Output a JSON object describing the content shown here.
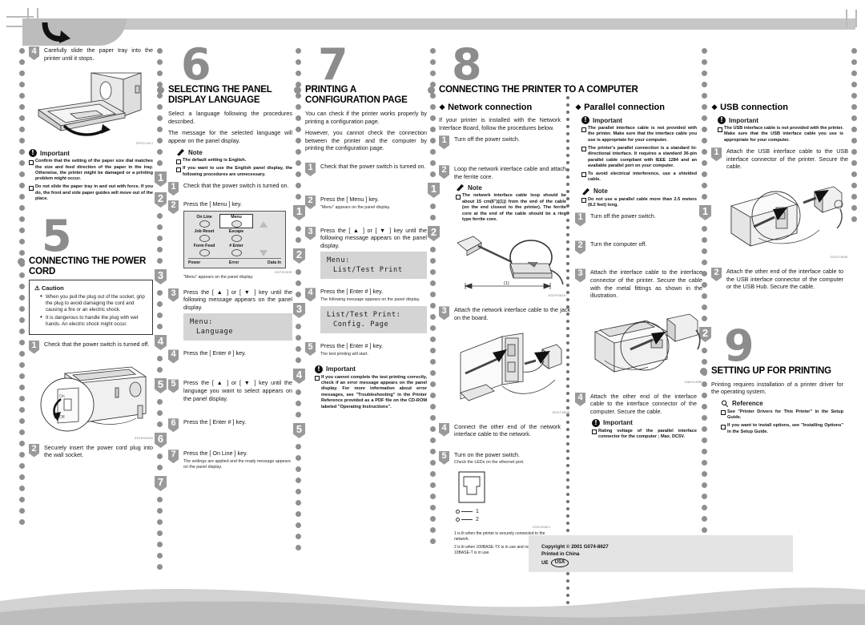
{
  "document": {
    "type": "printer-quick-installation-guide",
    "footer": {
      "copyright": "Copyright © 2001 G074-8627",
      "printed": "Printed in China",
      "ue_label": "UE",
      "region": "USA"
    }
  },
  "col1": {
    "step4": {
      "num": "4",
      "text": "Carefully slide the paper tray into the printer until it stops.",
      "figcode": "ZFEV140J"
    },
    "important": {
      "heading": "Important",
      "icon": "important-icon",
      "items": [
        "Confirm that the setting of the paper size dial matches the size and feed direction of the paper in the tray. Otherwise, the printer might be damaged or a printing problem might occur.",
        "Do not slide the paper tray in and out with force. If you do, the front and side paper guides will move out of the place."
      ]
    },
    "section5": {
      "number": "5",
      "title": "CONNECTING THE POWER CORD",
      "caution": {
        "heading": "Caution",
        "items": [
          "When you pull the plug out of the socket, grip the plug to avoid damaging the cord and causing a fire or an electric shock.",
          "It is dangerous to handle the plug with wet hands. An electric shock might occur."
        ]
      },
      "steps": [
        {
          "num": "1",
          "text": "Check that the power switch is turned off.",
          "figcode": "ZDHH204N"
        },
        {
          "num": "2",
          "text": "Securely insert the power cord plug into the wall socket."
        }
      ]
    }
  },
  "col2": {
    "section6": {
      "number": "6",
      "title": "SELECTING THE PANEL DISPLAY LANGUAGE",
      "intro1": "Select a language following the procedures described.",
      "intro2": "The message for the selected language will appear on the panel display.",
      "note": {
        "heading": "Note",
        "items": [
          "The default setting is English.",
          "If you want to use the English panel display, the following procedures are unnecessary."
        ]
      },
      "steps": [
        {
          "num": "1",
          "text": "Check that the power switch is turned on."
        },
        {
          "num": "2",
          "text": "Press the [ Menu ] key.",
          "caption": "\"Menu\" appears on the panel display."
        },
        {
          "num": "3",
          "text": "Press the [ ▲ ] or [ ▼ ] key until the following message appears on the panel display.",
          "lcd1": "Menu:",
          "lcd2": "Language"
        },
        {
          "num": "4",
          "text": "Press the [ Enter # ] key."
        },
        {
          "num": "5",
          "text": "Press the [ ▲ ] or [ ▼ ] key until the language you want to select appears on the panel display."
        },
        {
          "num": "6",
          "text": "Press the [ Enter # ] key."
        },
        {
          "num": "7",
          "text": "Press the [ On Line ] key.",
          "caption": "The settings are applied and the ready message appears on the panel display."
        }
      ],
      "panel": {
        "keys": [
          "On Line",
          "Menu",
          "Job Reset",
          "Escape",
          "Form Feed",
          "# Enter"
        ],
        "leds": [
          "Power",
          "Error",
          "Data In"
        ],
        "figcode": "ZDFS030E"
      }
    }
  },
  "col3": {
    "section7": {
      "number": "7",
      "title": "PRINTING A CONFIGURATION PAGE",
      "intro1": "You can check if the printer works properly by printing a configuration page.",
      "intro2": "However, you cannot check the connection between the printer and the computer by printing the configuration page.",
      "steps": [
        {
          "num": "1",
          "text": "Check that the power switch is turned on."
        },
        {
          "num": "2",
          "text": "Press the [ Menu ] key.",
          "caption": "\"Menu\" appears on the panel display."
        },
        {
          "num": "3",
          "text": "Press the [ ▲ ] or [ ▼ ] key until the following message appears on the panel display.",
          "lcd1": "Menu:",
          "lcd2": "List/Test Print"
        },
        {
          "num": "4",
          "text": "Press the [ Enter # ] key.",
          "caption": "The following message appears on the panel display.",
          "lcd1": "List/Test Print:",
          "lcd2": "Config. Page"
        },
        {
          "num": "5",
          "text": "Press the [ Enter # ] key.",
          "caption": "The test printing will start."
        }
      ],
      "important": {
        "heading": "Important",
        "items": [
          "If you cannot complete the test printing correctly, check if an error message appears on the panel display. For more information about error messages, see \"Troubleshooting\" in the Printer Reference provided as a PDF file on the CD-ROM labeled \"Operating Instructions\"."
        ]
      }
    }
  },
  "section8": {
    "number": "8",
    "title": "CONNECTING THE PRINTER TO A COMPUTER",
    "network": {
      "heading": "Network connection",
      "intro": "If your printer is installed with the Network Interface Board, follow the procedures below.",
      "steps": [
        {
          "num": "1",
          "text": "Turn off the power switch."
        },
        {
          "num": "2",
          "text": "Loop the network interface cable and attach the ferrite core."
        },
        {
          "num": "3",
          "text": "Attach the network interface cable to the jack on the board.",
          "figcode": "ZDGT260E"
        },
        {
          "num": "4",
          "text": "Connect the other end of the network interface cable to the network."
        },
        {
          "num": "5",
          "text": "Turn on the power switch.",
          "caption": "Check the LEDs on the ethernet port."
        }
      ],
      "note": {
        "heading": "Note",
        "items": [
          "The network interface cable loop should be about 15 cm(6\")((1)) from the end of the cable (on the end closest to the printer). The ferrite core at the end of the cable should be a ring type ferrite core."
        ]
      },
      "ferrite_fig": {
        "dim_label": "(1)",
        "figcode": "ZGDP081E"
      },
      "leds": {
        "items": [
          "1",
          "2"
        ],
        "figcode": "ZGEH080J"
      },
      "footnotes": [
        "1 is lit when the printer is securely connected to the network.",
        "2 is lit when 100BASE-TX is in use and not lit when 10BASE-T is in use."
      ]
    },
    "parallel": {
      "heading": "Parallel connection",
      "important": {
        "heading": "Important",
        "items": [
          "The parallel interface cable is not provided with the printer. Make sure that the interface cable you use is appropriate for your computer.",
          "The printer's parallel connection is a standard bi-directional interface. It requires a standard 36-pin parallel cable compliant with IEEE 1284 and an available parallel port on your computer.",
          "To avoid electrical interference, use a shielded cable."
        ]
      },
      "note": {
        "heading": "Note",
        "items": [
          "Do not use a parallel cable more than 2.5 meters (8.2 feet) long."
        ]
      },
      "steps": [
        {
          "num": "1",
          "text": "Turn off the power switch."
        },
        {
          "num": "2",
          "text": "Turn the computer off."
        },
        {
          "num": "3",
          "text": "Attach the interface cable to the interface connector of the printer. Secure the cable with the metal fittings as shown in the illustration.",
          "figcode": "ZAKH105E"
        },
        {
          "num": "4",
          "text": "Attach the other end of the interface cable to the interface connector of the computer. Secure the cable."
        }
      ],
      "important2": {
        "heading": "Important",
        "items": [
          "Rating voltage of the parallel interface connector for the computer ; Max. DC5V."
        ]
      }
    },
    "usb": {
      "heading": "USB connection",
      "important": {
        "heading": "Important",
        "items": [
          "The USB interface cable is not provided with the printer. Make sure that the USB interface cable you use is appropriate for your computer."
        ]
      },
      "steps": [
        {
          "num": "1",
          "text": "Attach the USB interface cable to the USB interface connector of the printer. Secure the cable.",
          "figcode": "ZGDT080E"
        },
        {
          "num": "2",
          "text": "Attach the other end of the interface cable to the USB interface connector of the computer or the USB Hub. Secure the cable."
        }
      ]
    }
  },
  "section9": {
    "number": "9",
    "title": "SETTING UP FOR PRINTING",
    "intro": "Printing requires installation of a printer driver for the operating system.",
    "reference": {
      "heading": "Reference",
      "items": [
        "See \"Printer Drivers for This Printer\" in the Setup Guide.",
        "If you want to install options, see \"Installing Options\" in the Setup Guide."
      ]
    }
  }
}
